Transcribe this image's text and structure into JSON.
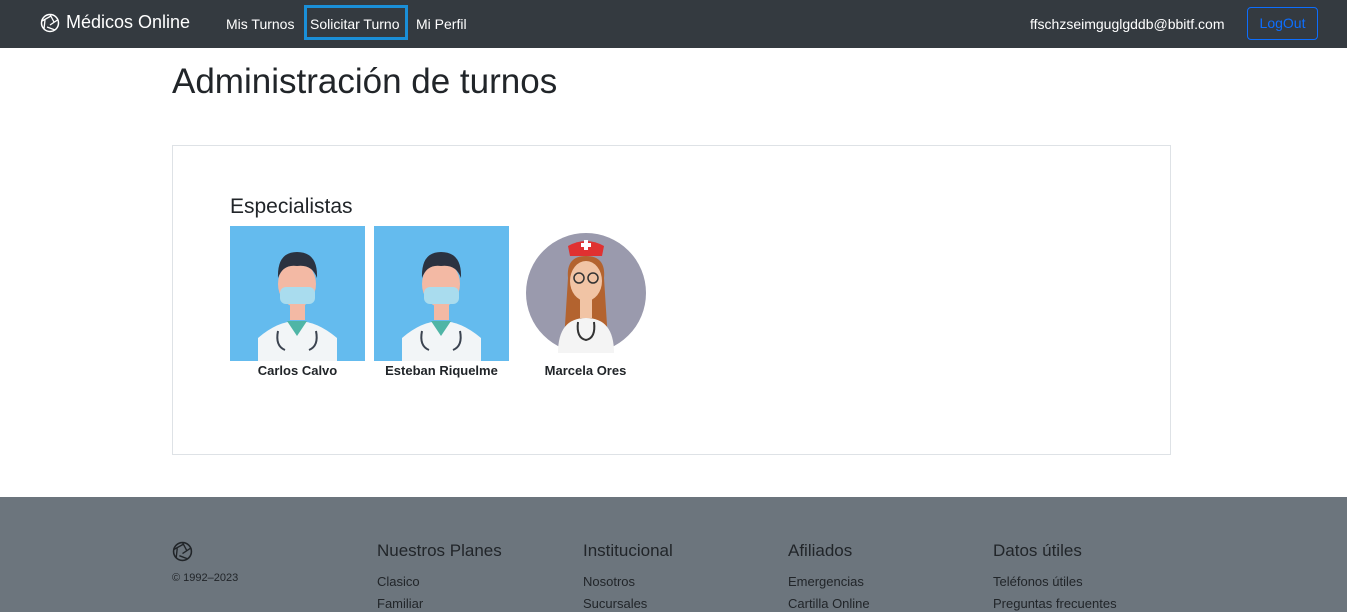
{
  "navbar": {
    "brand": "Médicos Online",
    "links": [
      "Mis Turnos",
      "Solicitar Turno",
      "Mi Perfil"
    ],
    "user_email": "ffschzseimguglgddb@bbitf.com",
    "logout_label": "LogOut"
  },
  "main": {
    "title": "Administración de turnos",
    "section_title": "Especialistas",
    "specialists": [
      {
        "name": "Carlos Calvo",
        "avatar": "male-doctor-mask-icon"
      },
      {
        "name": "Esteban Riquelme",
        "avatar": "male-doctor-mask-icon"
      },
      {
        "name": "Marcela Ores",
        "avatar": "female-nurse-icon"
      }
    ]
  },
  "footer": {
    "copyright": "© 1992–2023",
    "columns": [
      {
        "title": "Nuestros Planes",
        "links": [
          "Clasico",
          "Familiar"
        ]
      },
      {
        "title": "Institucional",
        "links": [
          "Nosotros",
          "Sucursales"
        ]
      },
      {
        "title": "Afiliados",
        "links": [
          "Emergencias",
          "Cartilla Online"
        ]
      },
      {
        "title": "Datos útiles",
        "links": [
          "Teléfonos útiles",
          "Preguntas frecuentes"
        ]
      }
    ]
  },
  "colors": {
    "navbar_bg": "#343a40",
    "footer_bg": "#6c757d",
    "accent": "#0d6efd",
    "highlight": "#1a8fd8",
    "avatar_bg": "#64bbee"
  }
}
